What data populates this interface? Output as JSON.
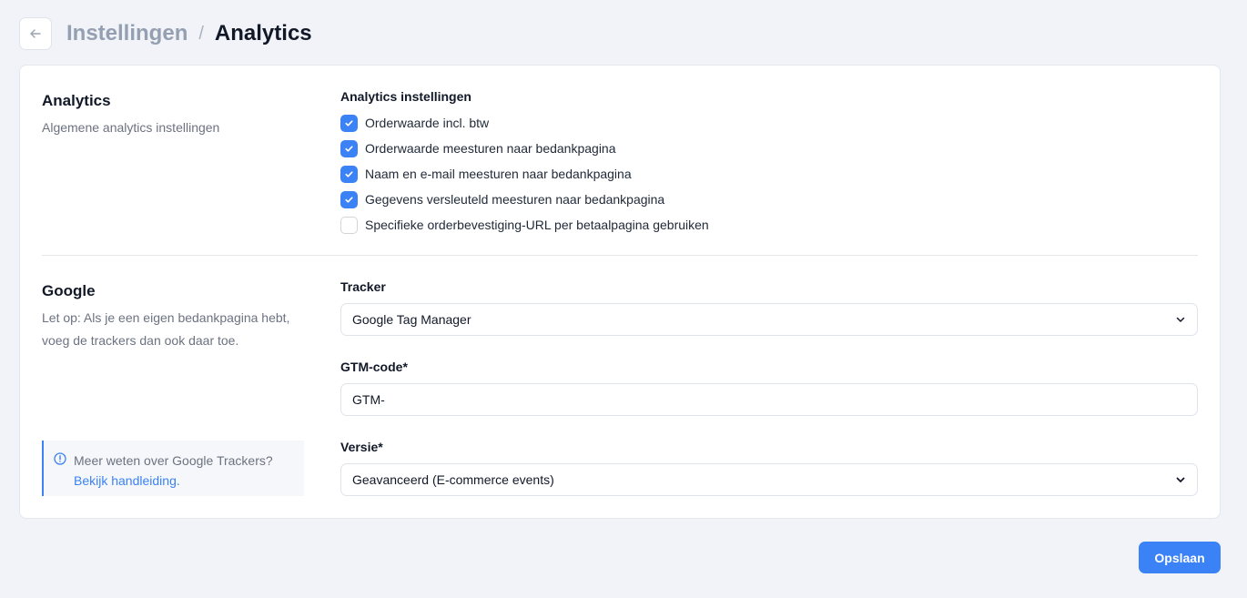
{
  "header": {
    "breadcrumb_parent": "Instellingen",
    "breadcrumb_separator": "/",
    "breadcrumb_current": "Analytics"
  },
  "analytics": {
    "title": "Analytics",
    "description": "Algemene analytics instellingen",
    "settings_label": "Analytics instellingen",
    "options": [
      {
        "label": "Orderwaarde incl. btw",
        "checked": true
      },
      {
        "label": "Orderwaarde meesturen naar bedankpagina",
        "checked": true
      },
      {
        "label": "Naam en e-mail meesturen naar bedankpagina",
        "checked": true
      },
      {
        "label": "Gegevens versleuteld meesturen naar bedankpagina",
        "checked": true
      },
      {
        "label": "Specifieke orderbevestiging-URL per betaalpagina gebruiken",
        "checked": false
      }
    ]
  },
  "google": {
    "title": "Google",
    "description": "Let op: Als je een eigen bedankpagina hebt, voeg de trackers dan ook daar toe.",
    "tracker_label": "Tracker",
    "tracker_value": "Google Tag Manager",
    "gtm_label": "GTM-code*",
    "gtm_value": "GTM-",
    "version_label": "Versie*",
    "version_value": "Geavanceerd (E-commerce events)",
    "info_text": "Meer weten over Google Trackers?",
    "info_link": "Bekijk handleiding."
  },
  "actions": {
    "save_label": "Opslaan"
  },
  "colors": {
    "accent": "#3b82f6",
    "background": "#f1f3f8"
  }
}
